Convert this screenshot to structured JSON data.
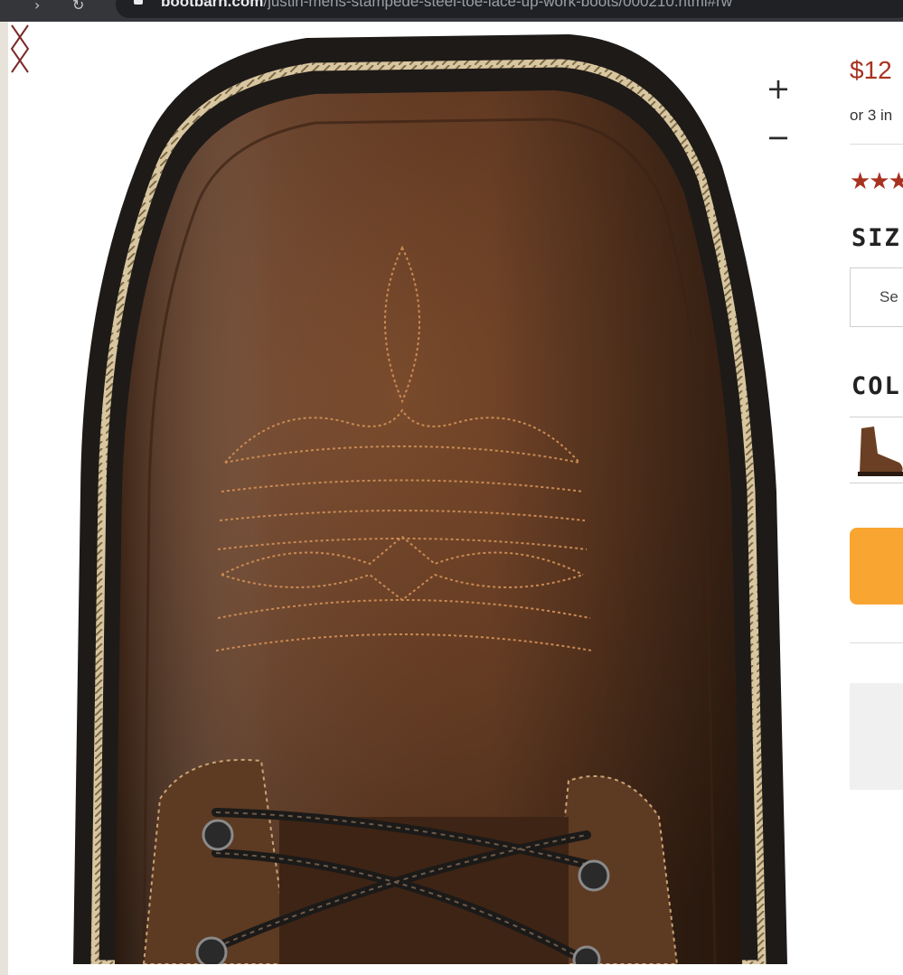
{
  "browser": {
    "nav_back": "›",
    "nav_reload": "↻",
    "url_host": "bootbarn.com",
    "url_path": "/justin-mens-stampede-steel-toe-lace-up-work-boots/000210.html#rw"
  },
  "gallery": {
    "zoom_in_label": "+",
    "zoom_out_label": "−",
    "prev_icon": "chevron-left-icon",
    "next_icon": "chevron-right-icon",
    "image_alt": "Brown leather work boot toe with decorative stitching"
  },
  "product": {
    "price": "$12",
    "installments": "or 3 in",
    "rating_stars": "★★★",
    "size_label": "SIZ",
    "size_select_placeholder": "Se",
    "color_label": "COL"
  },
  "colors": {
    "price_red": "#a83220",
    "cart_orange": "#f8a532",
    "leather_brown": "#6b3f23"
  }
}
